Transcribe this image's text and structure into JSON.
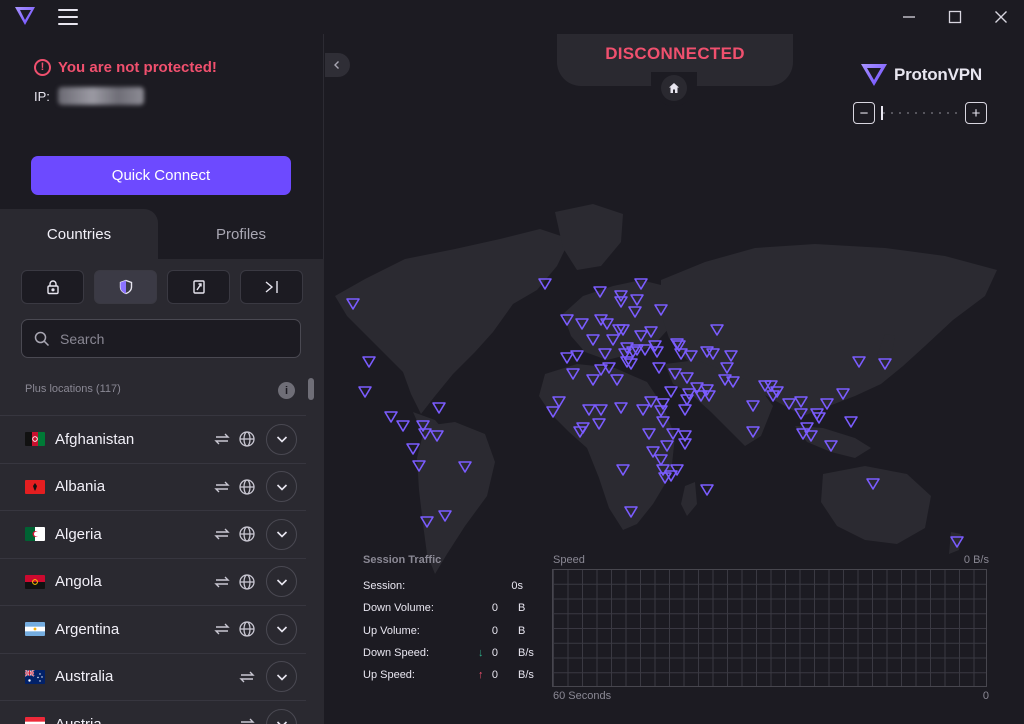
{
  "app": {
    "name": "ProtonVPN"
  },
  "titlebar": {
    "icons": [
      "proton-logo-icon",
      "hamburger-menu-icon",
      "minimize-icon",
      "maximize-icon",
      "close-icon"
    ]
  },
  "status": {
    "message": "You are not protected!",
    "ip_label": "IP:",
    "ip_value": "",
    "state": "DISCONNECTED",
    "colors": {
      "warning": "#f0506e",
      "accent": "#6d4aff",
      "marker": "#7b5cff"
    }
  },
  "quick_connect": {
    "label": "Quick Connect"
  },
  "tabs": [
    {
      "label": "Countries",
      "active": true
    },
    {
      "label": "Profiles",
      "active": false
    }
  ],
  "filters": [
    {
      "icon": "lock-icon",
      "active": false
    },
    {
      "icon": "shield-icon",
      "active": true
    },
    {
      "icon": "p2p-icon",
      "active": false
    },
    {
      "icon": "tor-icon",
      "active": false
    }
  ],
  "search": {
    "placeholder": "Search",
    "value": ""
  },
  "list": {
    "header": "Plus locations (117)",
    "countries": [
      {
        "name": "Afghanistan",
        "icons": [
          "p2p-arrows-icon",
          "globe-icon"
        ]
      },
      {
        "name": "Albania",
        "icons": [
          "p2p-arrows-icon",
          "globe-icon"
        ]
      },
      {
        "name": "Algeria",
        "icons": [
          "p2p-arrows-icon",
          "globe-icon"
        ]
      },
      {
        "name": "Angola",
        "icons": [
          "p2p-arrows-icon",
          "globe-icon"
        ]
      },
      {
        "name": "Argentina",
        "icons": [
          "p2p-arrows-icon",
          "globe-icon"
        ]
      },
      {
        "name": "Australia",
        "icons": [
          "p2p-arrows-icon"
        ]
      },
      {
        "name": "Austria",
        "icons": [
          "p2p-arrows-icon"
        ]
      }
    ]
  },
  "map": {
    "zoom_minus": "−",
    "zoom_plus": "+"
  },
  "traffic": {
    "title": "Session Traffic",
    "session": {
      "label": "Session:",
      "value": "0s",
      "unit": ""
    },
    "down_volume": {
      "label": "Down Volume:",
      "value": "0",
      "unit": "B"
    },
    "up_volume": {
      "label": "Up Volume:",
      "value": "0",
      "unit": "B"
    },
    "down_speed": {
      "label": "Down Speed:",
      "value": "0",
      "unit": "B/s",
      "arrow": "↓"
    },
    "up_speed": {
      "label": "Up Speed:",
      "value": "0",
      "unit": "B/s",
      "arrow": "↑"
    }
  },
  "speed_chart": {
    "label": "Speed",
    "max_label": "0 B/s",
    "x_left": "60 Seconds",
    "x_right": "0"
  }
}
